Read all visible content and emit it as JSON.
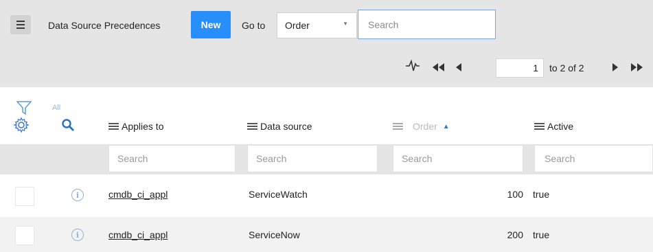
{
  "header": {
    "list_title": "Data Source Precedences",
    "new_label": "New",
    "goto_label": "Go to",
    "goto_selected": "Order",
    "search_placeholder": "Search"
  },
  "pager": {
    "current": "1",
    "range_text": "to 2 of 2"
  },
  "filter": {
    "breadcrumb": "All"
  },
  "columns": [
    {
      "label": "Applies to",
      "search_placeholder": "Search"
    },
    {
      "label": "Data source",
      "search_placeholder": "Search"
    },
    {
      "label": "Order",
      "search_placeholder": "Search",
      "sorted": "ascending"
    },
    {
      "label": "Active",
      "search_placeholder": "Search"
    }
  ],
  "rows": [
    {
      "applies_to": "cmdb_ci_appl",
      "data_source": "ServiceWatch",
      "order": "100",
      "active": "true"
    },
    {
      "applies_to": "cmdb_ci_appl",
      "data_source": "ServiceNow",
      "order": "200",
      "active": "true"
    }
  ],
  "colors": {
    "accent": "#278efc",
    "header_bg": "#e5e5e5",
    "filter_icon": "#5b9bd5",
    "sort_indicator": "#3a78c8"
  },
  "icons": [
    "menu-icon",
    "activity-icon",
    "first-page-icon",
    "prev-page-icon",
    "next-page-icon",
    "last-page-icon",
    "filter-icon",
    "gear-icon",
    "search-icon",
    "column-menu-icon",
    "info-icon"
  ]
}
